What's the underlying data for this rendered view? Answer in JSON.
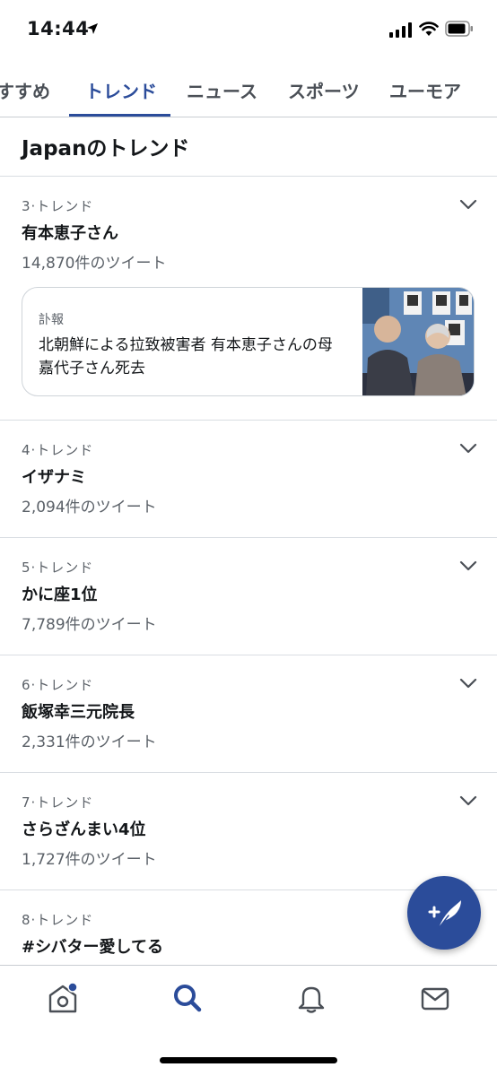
{
  "status_bar": {
    "time": "14:44"
  },
  "tabs": [
    {
      "label": "すすめ"
    },
    {
      "label": "トレンド"
    },
    {
      "label": "ニュース"
    },
    {
      "label": "スポーツ"
    },
    {
      "label": "ユーモア"
    }
  ],
  "section": {
    "title": "Japanのトレンド"
  },
  "trends": [
    {
      "rank": "3·トレンド",
      "name": "有本恵子さん",
      "count": "14,870件のツイート"
    },
    {
      "rank": "4·トレンド",
      "name": "イザナミ",
      "count": "2,094件のツイート"
    },
    {
      "rank": "5·トレンド",
      "name": "かに座1位",
      "count": "7,789件のツイート"
    },
    {
      "rank": "6·トレンド",
      "name": "飯塚幸三元院長",
      "count": "2,331件のツイート"
    },
    {
      "rank": "7·トレンド",
      "name": "さらざんまい4位",
      "count": "1,727件のツイート"
    },
    {
      "rank": "8·トレンド",
      "name": "#シバター愛してる",
      "count": ""
    }
  ],
  "news_card": {
    "category": "訃報",
    "headline": "北朝鮮による拉致被害者 有本恵子さんの母 嘉代子さん死去"
  },
  "icons": {
    "location": "location-arrow-icon",
    "signal": "cellular-signal-icon",
    "wifi": "wifi-icon",
    "battery": "battery-icon",
    "chevron": "chevron-down-icon",
    "compose": "compose-tweet-icon",
    "home": "home-icon",
    "search": "search-icon",
    "notifications": "bell-icon",
    "messages": "mail-icon"
  },
  "colors": {
    "accent": "#2b4c9a",
    "notification_dot": "#2b4c9a",
    "text_primary": "#14171a",
    "text_secondary": "#5b6168"
  }
}
